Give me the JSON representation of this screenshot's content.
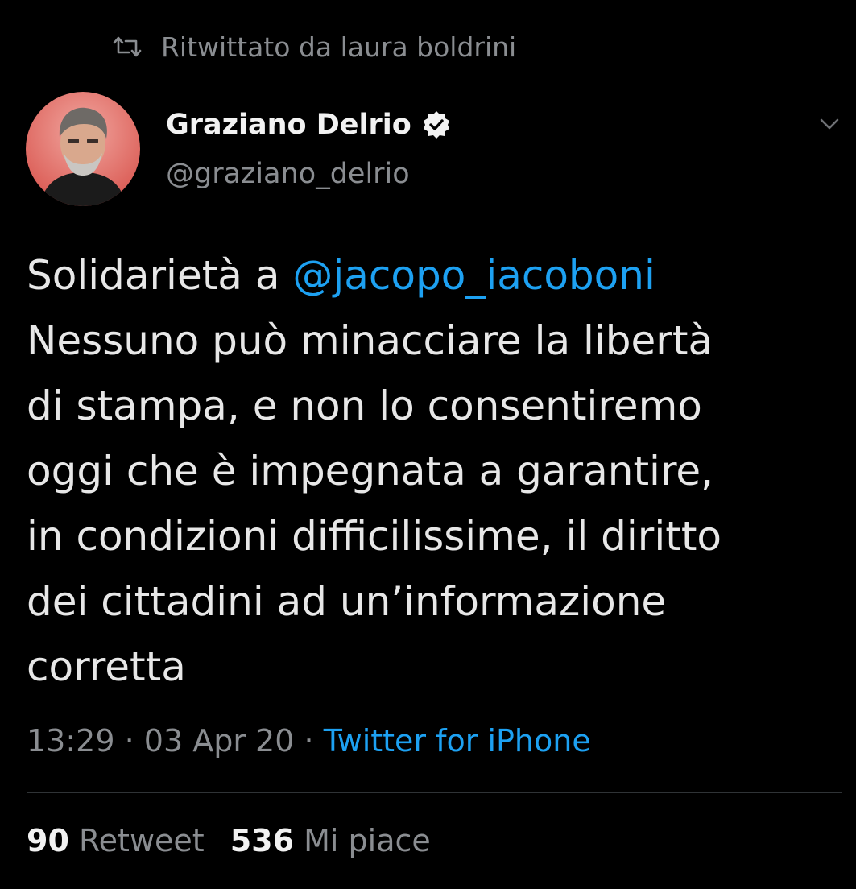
{
  "retweet_banner": {
    "icon": "retweet-icon",
    "text": "Ritwittato da laura boldrini"
  },
  "author": {
    "name": "Graziano Delrio",
    "handle": "@graziano_delrio",
    "verified": true,
    "verified_icon": "verified-badge-icon",
    "avatar": "avatar"
  },
  "menu": {
    "icon": "chevron-down-icon"
  },
  "tweet": {
    "line1_prefix": "Solidarietà a ",
    "line1_mention": "@jacopo_iacoboni",
    "line2": "Nessuno può minacciare la libertà",
    "line3": "di stampa, e non lo consentiremo",
    "line4": "oggi che è impegnata a garantire,",
    "line5": "in condizioni difficilissime, il diritto",
    "line6": "dei cittadini ad un’informazione",
    "line7": "corretta"
  },
  "meta": {
    "time": "13:29",
    "separator": "·",
    "date": "03 Apr 20",
    "source": "Twitter for iPhone"
  },
  "stats": {
    "retweets_count": "90",
    "retweets_label": "Retweet",
    "likes_count": "536",
    "likes_label": "Mi piace"
  },
  "colors": {
    "background": "#000000",
    "link": "#1da1f2",
    "muted": "#8a8d91",
    "text": "#e7e7e7",
    "divider": "#2f3336"
  }
}
